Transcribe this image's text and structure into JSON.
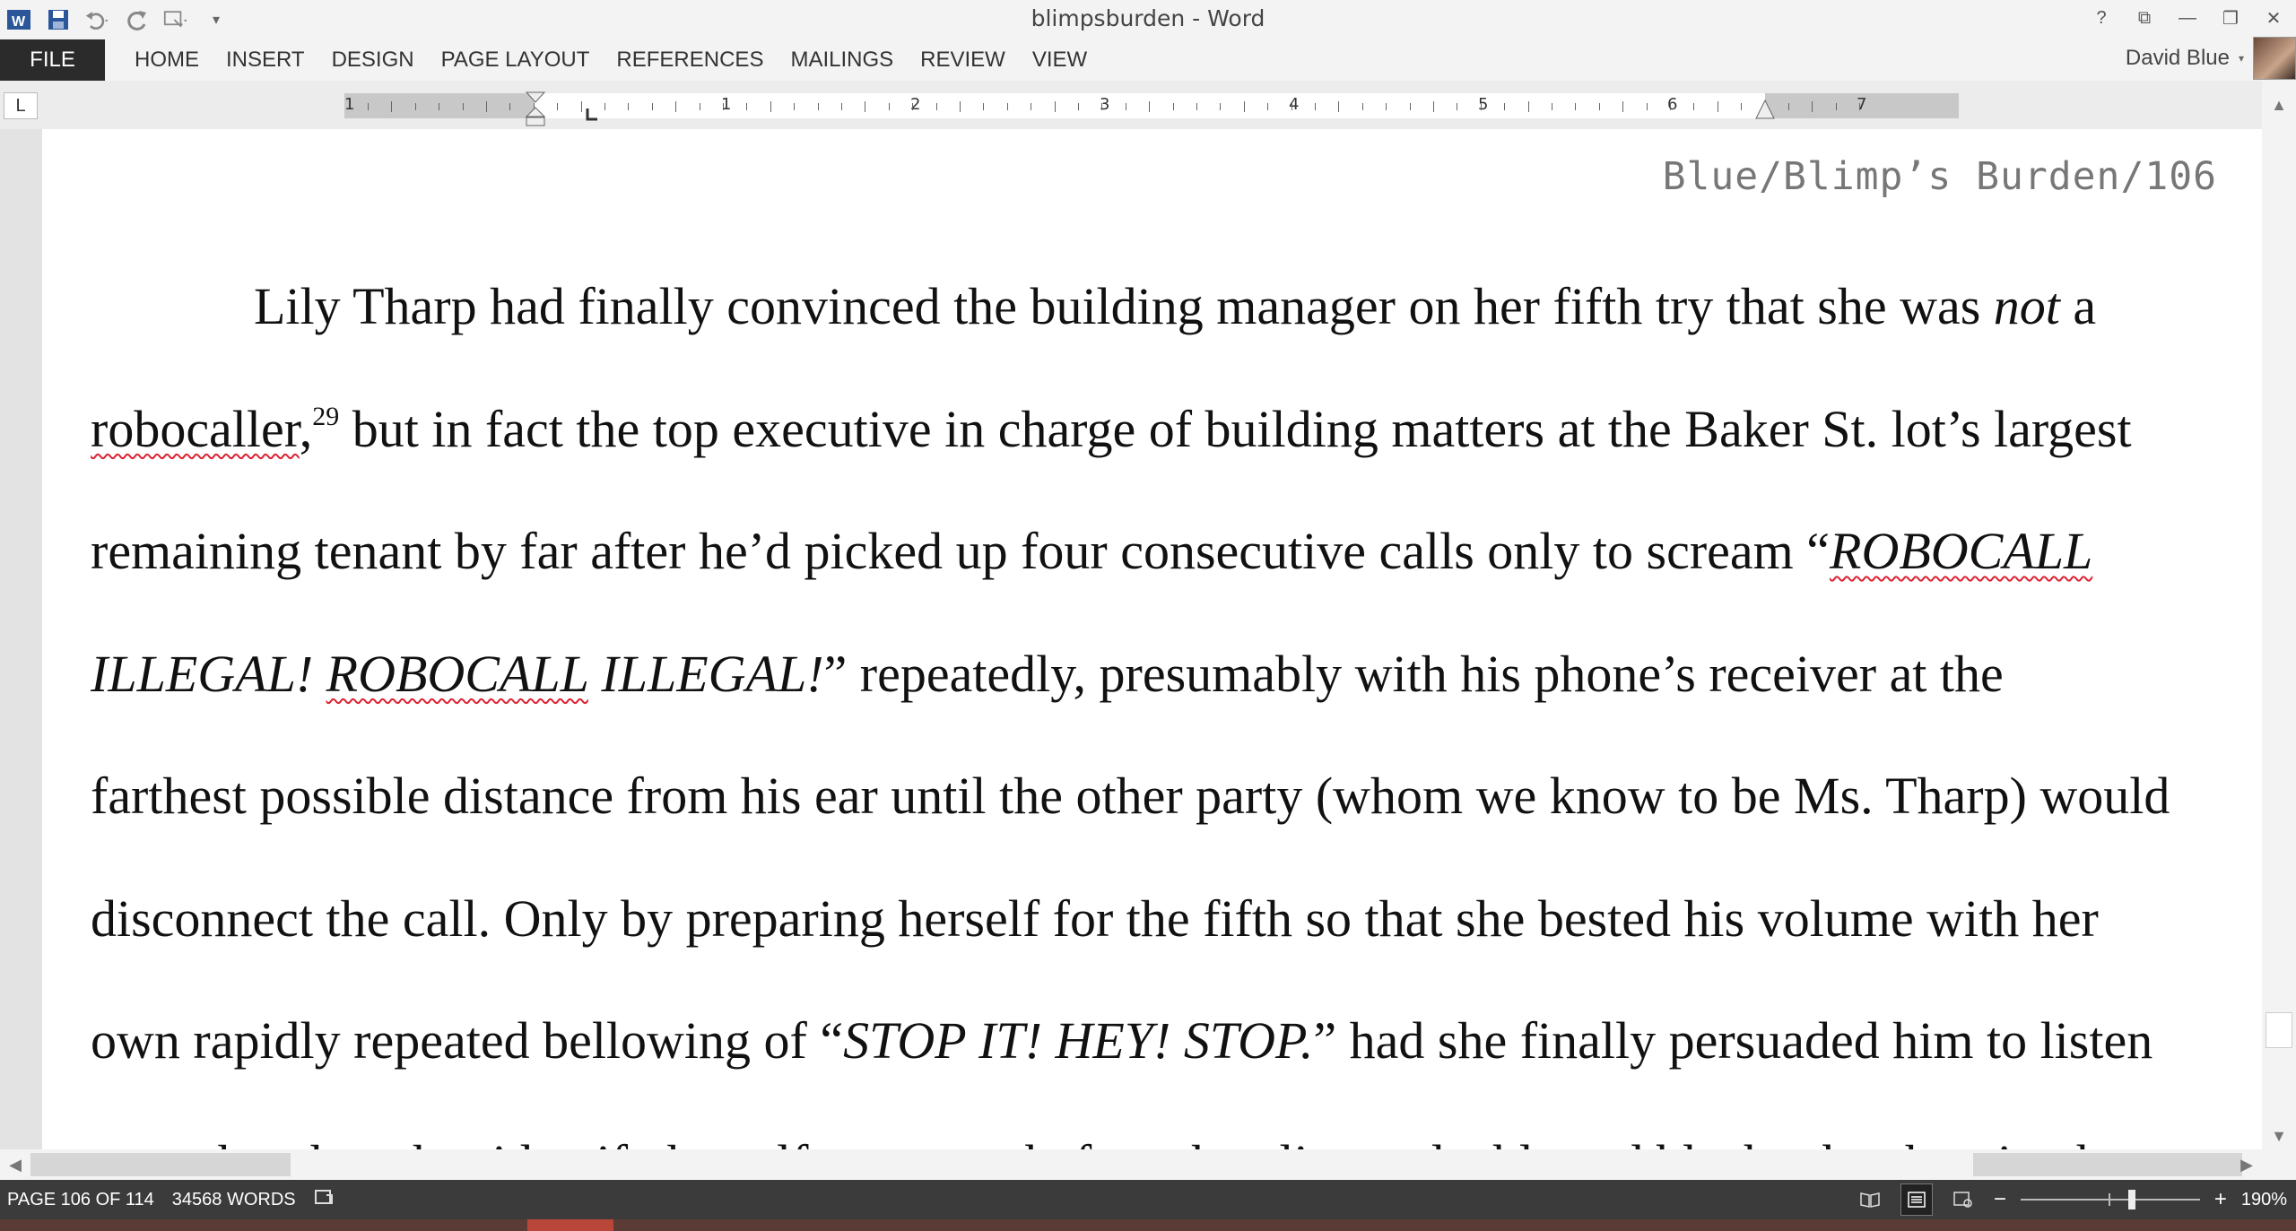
{
  "window": {
    "title": "blimpsburden - Word",
    "help": "?",
    "ribbon_display": "⧉",
    "minimize": "—",
    "restore": "❐",
    "close": "✕"
  },
  "qat": {
    "word_icon": "W",
    "save_icon": "💾",
    "undo_icon": "↶",
    "redo_icon": "↻",
    "touch_icon": "☐",
    "customize_icon": "▾"
  },
  "ribbon": {
    "file": "FILE",
    "tabs": [
      "HOME",
      "INSERT",
      "DESIGN",
      "PAGE LAYOUT",
      "REFERENCES",
      "MAILINGS",
      "REVIEW",
      "VIEW"
    ],
    "user_name": "David Blue",
    "user_caret": "▾"
  },
  "ruler": {
    "tab_selector": "L",
    "numbers": [
      "1",
      "1",
      "2",
      "3",
      "4",
      "5",
      "6",
      "7"
    ]
  },
  "document": {
    "header": "Blue/Blimp’s Burden/106",
    "lines": [
      {
        "parts": [
          {
            "t": "Lily Tharp had finally convinced the building manager on her fifth try that she was "
          },
          {
            "t": "not",
            "i": true
          },
          {
            "t": " a"
          }
        ]
      },
      {
        "parts": [
          {
            "t": "robocaller",
            "sp": true
          },
          {
            "t": ","
          },
          {
            "t": "29",
            "sup": true
          },
          {
            "t": " but in fact the top executive in charge of building matters at the Baker St. lot’s largest"
          }
        ]
      },
      {
        "parts": [
          {
            "t": "remaining tenant by far after he’d picked up four consecutive calls only to scream “"
          },
          {
            "t": "ROBOCALL",
            "i": true,
            "sp": true
          }
        ]
      },
      {
        "parts": [
          {
            "t": "ILLEGAL! ",
            "i": true
          },
          {
            "t": "ROBOCALL",
            "i": true,
            "sp": true
          },
          {
            "t": " ILLEGAL!",
            "i": true
          },
          {
            "t": "” repeatedly, presumably with his phone’s receiver at the"
          }
        ]
      },
      {
        "parts": [
          {
            "t": "farthest possible distance from his ear until the other party (whom we know to be Ms. Tharp) would"
          }
        ]
      },
      {
        "parts": [
          {
            "t": "disconnect the call. Only by preparing herself for the fifth so that she bested his volume with her"
          }
        ]
      },
      {
        "parts": [
          {
            "t": "own rapidly repeated bellowing of “"
          },
          {
            "t": "STOP IT! HEY! STOP.",
            "i": true
          },
          {
            "t": "” had she finally persuaded him to listen"
          }
        ]
      },
      {
        "parts": [
          {
            "t": "enough to hear her identify herself moments before she glimpsed a blurred black tube shooting by"
          }
        ]
      }
    ]
  },
  "status": {
    "page": "PAGE 106 OF 114",
    "words": "34568 WORDS",
    "proofing_icon": "📖",
    "zoom_out": "−",
    "zoom_in": "+",
    "zoom": "190%",
    "zoom_level_percent": 190
  },
  "scroll": {
    "up": "▲",
    "down": "▼",
    "left": "◀",
    "right": "▶"
  }
}
